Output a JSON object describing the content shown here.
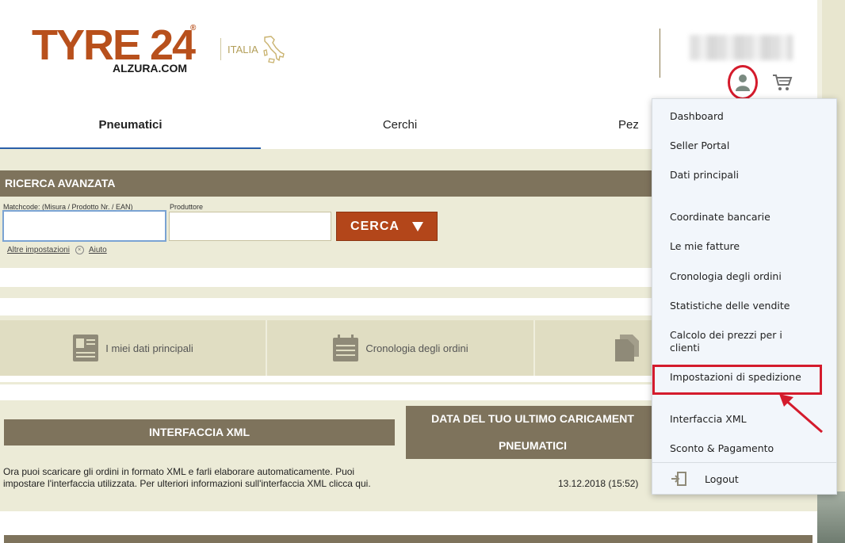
{
  "header": {
    "logo_text": "TYRE 24",
    "logo_sub": "ALZURA.COM",
    "logo_reg": "®",
    "country": "ITALIA"
  },
  "tabs": [
    {
      "label": "Pneumatici",
      "active": true
    },
    {
      "label": "Cerchi",
      "active": false
    },
    {
      "label": "Pez",
      "active": false
    }
  ],
  "search": {
    "title": "RICERCA AVANZATA",
    "matchcode_label": "Matchcode: (Misura / Prodotto Nr. / EAN)",
    "matchcode_value": "",
    "producer_label": "Produttore",
    "producer_value": "",
    "button_label": "CERCA",
    "more_settings": "Altre impostazioni",
    "help": "Aiuto"
  },
  "tiles": [
    {
      "label": "I miei dati principali",
      "icon": "id-card-icon"
    },
    {
      "label": "Cronologia degli ordini",
      "icon": "calendar-icon"
    },
    {
      "label": "",
      "icon": "documents-icon"
    }
  ],
  "xml": {
    "title": "INTERFACCIA XML",
    "date_title_line1": "DATA DEL TUO ULTIMO CARICAMENT",
    "date_title_line2": "PNEUMATICI",
    "description": "Ora puoi scaricare gli ordini in formato XML e farli elaborare automaticamente. Puoi impostare l'interfaccia utilizzata. Per ulteriori informazioni sull'interfaccia XML clicca qui.",
    "last_upload": "13.12.2018 (15:52)"
  },
  "menu": {
    "items": [
      "Dashboard",
      "Seller Portal",
      "Dati principali",
      "Coordinate bancarie",
      "Le mie fatture",
      "Cronologia degli ordini",
      "Statistiche delle vendite",
      "Calcolo dei prezzi per i clienti",
      "Impostazioni di spedizione",
      "Interfaccia XML",
      "Sconto & Pagamento"
    ],
    "logout": "Logout",
    "highlighted": "Impostazioni di spedizione"
  },
  "colors": {
    "brand": "#b8501c",
    "header_bar": "#7e735c",
    "background_band": "#ecebd7",
    "highlight": "#d41b2c",
    "tab_active": "#2a5fa8"
  }
}
